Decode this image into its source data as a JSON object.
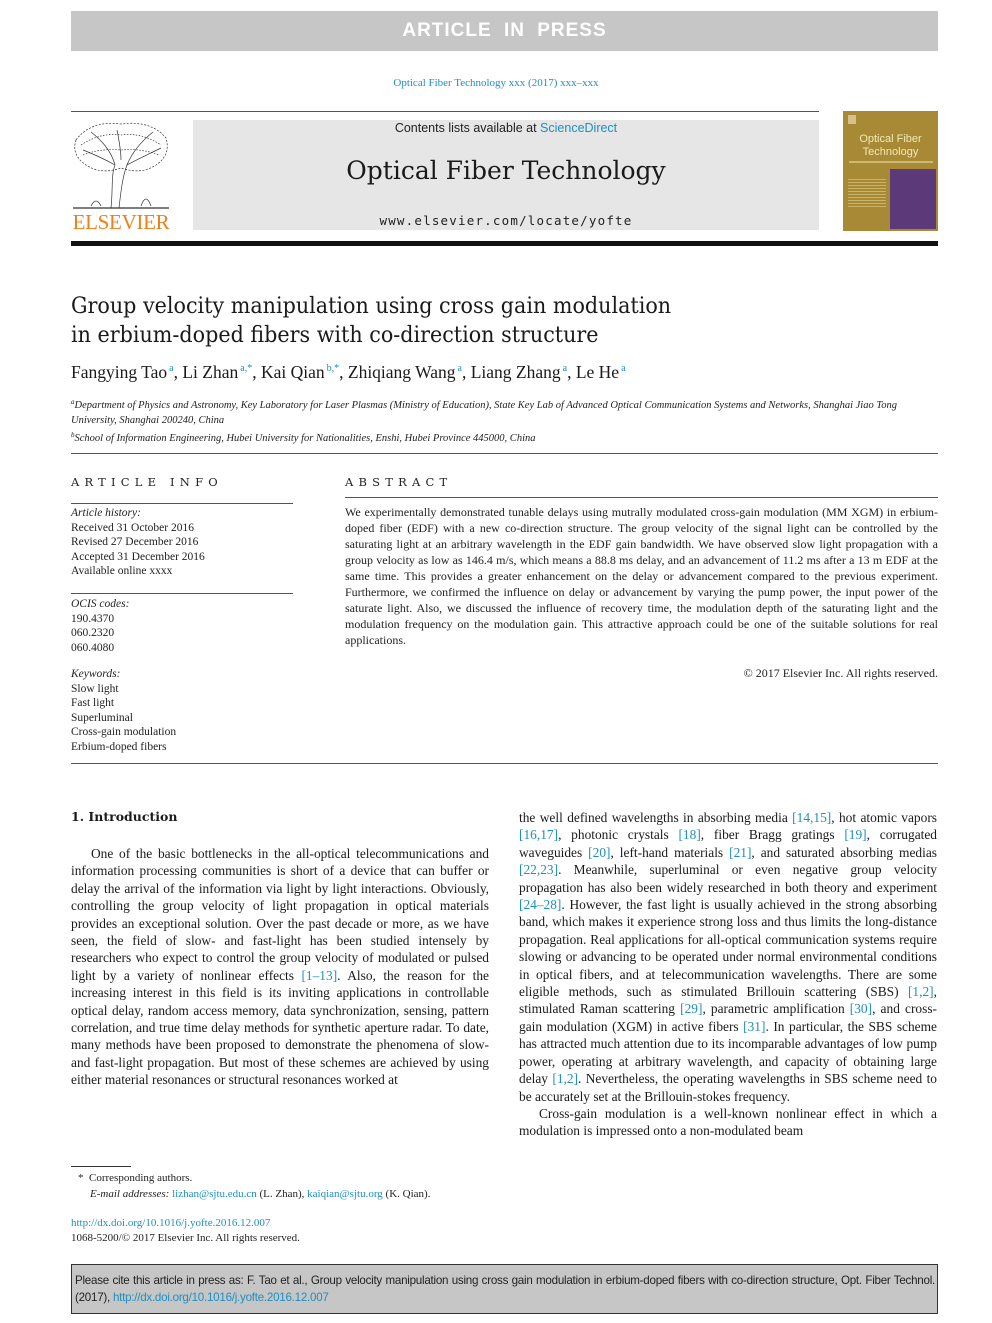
{
  "banner": "ARTICLE IN PRESS",
  "journal_ref": "Optical Fiber Technology xxx (2017) xxx–xxx",
  "publisher_logo_text": "ELSEVIER",
  "masthead": {
    "contents_prefix": "Contents lists available at ",
    "contents_link": "ScienceDirect",
    "journal_title": "Optical Fiber Technology",
    "journal_url": "www.elsevier.com/locate/yofte"
  },
  "cover": {
    "title_line1": "Optical Fiber",
    "title_line2": "Technology"
  },
  "article": {
    "title_line1": "Group velocity manipulation using cross gain modulation",
    "title_line2": "in erbium-doped fibers with co-direction structure",
    "authors": [
      {
        "name": "Fangying Tao",
        "sup": "a",
        "sep": ", "
      },
      {
        "name": "Li Zhan",
        "sup": "a,*",
        "sep": ", "
      },
      {
        "name": "Kai Qian",
        "sup": "b,*",
        "sep": ", "
      },
      {
        "name": "Zhiqiang Wang",
        "sup": "a",
        "sep": ", "
      },
      {
        "name": "Liang Zhang",
        "sup": "a",
        "sep": ", "
      },
      {
        "name": "Le He",
        "sup": "a",
        "sep": ""
      }
    ],
    "affiliations": [
      {
        "mark": "a",
        "text": "Department of Physics and Astronomy, Key Laboratory for Laser Plasmas (Ministry of Education), State Key Lab of Advanced Optical Communication Systems and Networks, Shanghai Jiao Tong University, Shanghai 200240, China"
      },
      {
        "mark": "b",
        "text": "School of Information Engineering, Hubei University for Nationalities, Enshi, Hubei Province 445000, China"
      }
    ]
  },
  "article_info": {
    "heading": "ARTICLE INFO",
    "history_label": "Article history:",
    "history": [
      "Received 31 October 2016",
      "Revised 27 December 2016",
      "Accepted 31 December 2016",
      "Available online xxxx"
    ],
    "ocis_label": "OCIS codes:",
    "ocis": [
      "190.4370",
      "060.2320",
      "060.4080"
    ],
    "keywords_label": "Keywords:",
    "keywords": [
      "Slow light",
      "Fast light",
      "Superluminal",
      "Cross-gain modulation",
      "Erbium-doped fibers"
    ]
  },
  "abstract": {
    "heading": "ABSTRACT",
    "text": "We experimentally demonstrated tunable delays using mutrally modulated cross-gain modulation (MM XGM) in erbium-doped fiber (EDF) with a new co-direction structure. The group velocity of the signal light can be controlled by the saturating light at an arbitrary wavelength in the EDF gain bandwidth. We have observed slow light propagation with a group velocity as low as 146.4 m/s, which means a 88.8 ms delay, and an advancement of 11.2 ms after a 13 m EDF at the same time. This provides a greater enhancement on the delay or advancement compared to the previous experiment. Furthermore, we confirmed the influence on delay or advancement by varying the pump power, the input power of the saturate light. Also, we discussed the influence of recovery time, the modulation depth of the saturating light and the modulation frequency on the modulation gain. This attractive approach could be one of the suitable solutions for real applications.",
    "copyright": "© 2017 Elsevier Inc. All rights reserved."
  },
  "introduction": {
    "heading": "1. Introduction",
    "left": [
      {
        "t": "One of the basic bottlenecks in the all-optical telecommunications and information processing communities is short of a device that can buffer or delay the arrival of the information via light by light interactions. Obviously, controlling the group velocity of light propagation in optical materials provides an exceptional solution. Over the past decade or more, as we have seen, the field of slow- and fast-light has been studied intensely by researchers who expect to control the group velocity of modulated or pulsed light by a variety of nonlinear effects "
      },
      {
        "ref": "[1–13]"
      },
      {
        "t": ". Also, the reason for the increasing interest in this field is its inviting applications in controllable optical delay, random access memory, data synchronization, sensing, pattern correlation, and true time delay methods for synthetic aperture radar. To date, many methods have been proposed to demonstrate the phenomena of slow- and fast-light propagation. But most of these schemes are achieved by using either material resonances or structural resonances worked at"
      }
    ],
    "right_p1": [
      {
        "t": "the well defined wavelengths in absorbing media "
      },
      {
        "ref": "[14,15]"
      },
      {
        "t": ", hot atomic vapors "
      },
      {
        "ref": "[16,17]"
      },
      {
        "t": ", photonic crystals "
      },
      {
        "ref": "[18]"
      },
      {
        "t": ", fiber Bragg gratings "
      },
      {
        "ref": "[19]"
      },
      {
        "t": ", corrugated waveguides "
      },
      {
        "ref": "[20]"
      },
      {
        "t": ", left-hand materials "
      },
      {
        "ref": "[21]"
      },
      {
        "t": ", and saturated absorbing medias "
      },
      {
        "ref": "[22,23]"
      },
      {
        "t": ". Meanwhile, superluminal or even negative group velocity propagation has also been widely researched in both theory and experiment "
      },
      {
        "ref": "[24–28]"
      },
      {
        "t": ". However, the fast light is usually achieved in the strong absorbing band, which makes it experience strong loss and thus limits the long-distance propagation. Real applications for all-optical communication systems require slowing or advancing to be operated under normal environmental conditions in optical fibers, and at telecommunication wavelengths. There are some eligible methods, such as stimulated Brillouin scattering (SBS) "
      },
      {
        "ref": "[1,2]"
      },
      {
        "t": ", stimulated Raman scattering "
      },
      {
        "ref": "[29]"
      },
      {
        "t": ", parametric amplification "
      },
      {
        "ref": "[30]"
      },
      {
        "t": ", and cross-gain modulation (XGM) in active fibers "
      },
      {
        "ref": "[31]"
      },
      {
        "t": ". In particular, the SBS scheme has attracted much attention due to its incomparable advantages of low pump power, operating at arbitrary wavelength, and capacity of obtaining large delay "
      },
      {
        "ref": "[1,2]"
      },
      {
        "t": ". Nevertheless, the operating wavelengths in SBS scheme need to be accurately set at the Brillouin-stokes frequency."
      }
    ],
    "right_p2": "Cross-gain modulation is a well-known nonlinear effect in which a modulation is impressed onto a non-modulated beam"
  },
  "footnotes": {
    "corresponding": "Corresponding authors.",
    "email_label": "E-mail addresses:",
    "email1": "lizhan@sjtu.edu.cn",
    "email1_owner": " (L. Zhan), ",
    "email2": "kaiqian@sjtu.org",
    "email2_owner": " (K. Qian)."
  },
  "doi": {
    "link": "http://dx.doi.org/10.1016/j.yofte.2016.12.007",
    "issn_copyright": "1068-5200/© 2017 Elsevier Inc. All rights reserved."
  },
  "cite_box": {
    "text": "Please cite this article in press as: F. Tao et al., Group velocity manipulation using cross gain modulation in erbium-doped fibers with co-direction structure, Opt. Fiber Technol. (2017), ",
    "link": "http://dx.doi.org/10.1016/j.yofte.2016.12.007"
  },
  "colors": {
    "link": "#1f8fbf",
    "elsevier_orange": "#f07f1b",
    "banner_gray": "#c6c6c6",
    "masthead_gray": "#e6e6e6"
  }
}
